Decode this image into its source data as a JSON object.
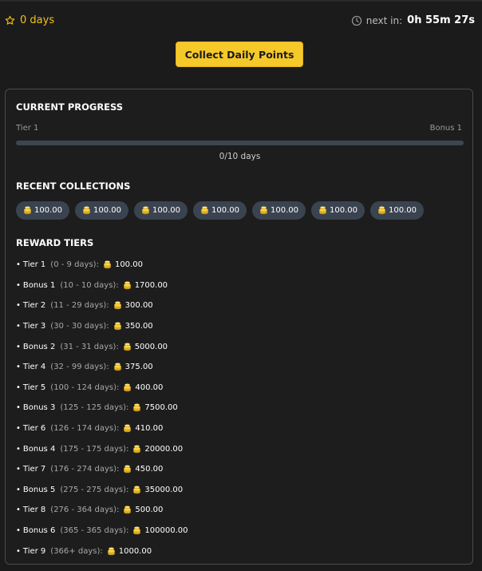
{
  "header": {
    "streak_text": "0 days",
    "next_in_label": "next in:",
    "next_in_value": "0h 55m 27s"
  },
  "collect_button_label": "Collect Daily Points",
  "progress": {
    "title": "CURRENT PROGRESS",
    "tier_label": "Tier 1",
    "bonus_label": "Bonus 1",
    "fraction": 0,
    "text": "0/10 days"
  },
  "recent": {
    "title": "RECENT COLLECTIONS",
    "items": [
      "100.00",
      "100.00",
      "100.00",
      "100.00",
      "100.00",
      "100.00",
      "100.00"
    ]
  },
  "tiers": {
    "title": "REWARD TIERS",
    "items": [
      {
        "name": "Tier 1",
        "range": "(0 - 9 days)",
        "amount": "100.00"
      },
      {
        "name": "Bonus 1",
        "range": "(10 - 10 days)",
        "amount": "1700.00"
      },
      {
        "name": "Tier 2",
        "range": "(11 - 29 days)",
        "amount": "300.00"
      },
      {
        "name": "Tier 3",
        "range": "(30 - 30 days)",
        "amount": "350.00"
      },
      {
        "name": "Bonus 2",
        "range": "(31 - 31 days)",
        "amount": "5000.00"
      },
      {
        "name": "Tier 4",
        "range": "(32 - 99 days)",
        "amount": "375.00"
      },
      {
        "name": "Tier 5",
        "range": "(100 - 124 days)",
        "amount": "400.00"
      },
      {
        "name": "Bonus 3",
        "range": "(125 - 125 days)",
        "amount": "7500.00"
      },
      {
        "name": "Tier 6",
        "range": "(126 - 174 days)",
        "amount": "410.00"
      },
      {
        "name": "Bonus 4",
        "range": "(175 - 175 days)",
        "amount": "20000.00"
      },
      {
        "name": "Tier 7",
        "range": "(176 - 274 days)",
        "amount": "450.00"
      },
      {
        "name": "Bonus 5",
        "range": "(275 - 275 days)",
        "amount": "35000.00"
      },
      {
        "name": "Tier 8",
        "range": "(276 - 364 days)",
        "amount": "500.00"
      },
      {
        "name": "Bonus 6",
        "range": "(365 - 365 days)",
        "amount": "100000.00"
      },
      {
        "name": "Tier 9",
        "range": "(366+ days)",
        "amount": "1000.00"
      }
    ]
  },
  "colors": {
    "accent": "#f6c92b",
    "background": "#1b1b1b",
    "chip_bg": "#3a4350",
    "track": "#3d4752"
  },
  "icons": {
    "streak": "star-outline-icon",
    "timer": "clock-icon",
    "coin": "coin-stack-icon"
  }
}
